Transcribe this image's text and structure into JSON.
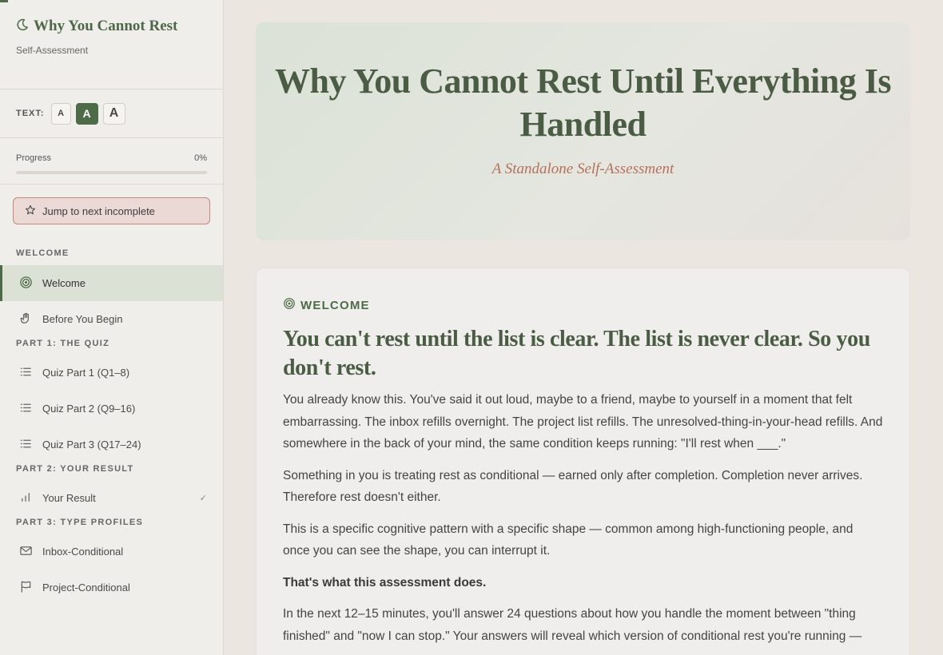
{
  "sidebar": {
    "brand_title": "Why You Cannot Rest",
    "brand_subtitle": "Self-Assessment",
    "text_size_label": "TEXT:",
    "text_size_options": [
      "A",
      "A",
      "A"
    ],
    "progress_label": "Progress",
    "progress_value": "0%",
    "progress_fraction": 0,
    "jump_label": "Jump to next incomplete",
    "sections": [
      {
        "title": "WELCOME",
        "items": [
          {
            "label": "Welcome",
            "icon": "target-icon",
            "active": true
          },
          {
            "label": "Before You Begin",
            "icon": "hand-icon"
          }
        ]
      },
      {
        "title": "PART 1: THE QUIZ",
        "items": [
          {
            "label": "Quiz Part 1 (Q1–8)",
            "icon": "list-icon"
          },
          {
            "label": "Quiz Part 2 (Q9–16)",
            "icon": "list-icon"
          },
          {
            "label": "Quiz Part 3 (Q17–24)",
            "icon": "list-icon"
          }
        ]
      },
      {
        "title": "PART 2: YOUR RESULT",
        "items": [
          {
            "label": "Your Result",
            "icon": "bar-chart-icon",
            "check": "✓"
          }
        ]
      },
      {
        "title": "PART 3: TYPE PROFILES",
        "items": [
          {
            "label": "Inbox-Conditional",
            "icon": "mail-icon"
          },
          {
            "label": "Project-Conditional",
            "icon": "flag-icon"
          }
        ]
      }
    ]
  },
  "hero": {
    "title": "Why You Cannot Rest Until Everything Is Handled",
    "subtitle": "A Standalone Self-Assessment"
  },
  "card": {
    "label": "WELCOME",
    "heading": "You can't rest until the list is clear. The list is never clear. So you don't rest.",
    "paragraphs": [
      "You already know this. You've said it out loud, maybe to a friend, maybe to yourself in a moment that felt embarrassing. The inbox refills overnight. The project list refills. The unresolved-thing-in-your-head refills. And somewhere in the back of your mind, the same condition keeps running: \"I'll rest when ___.\"",
      "Something in you is treating rest as conditional — earned only after completion. Completion never arrives. Therefore rest doesn't either.",
      "This is a specific cognitive pattern with a specific shape — common among high-functioning people, and once you can see the shape, you can interrupt it.",
      "That's what this assessment does.",
      "In the next 12–15 minutes, you'll answer 24 questions about how you handle the moment between \"thing finished\" and \"now I can stop.\" Your answers will reveal which version of conditional rest you're running —"
    ]
  },
  "colors": {
    "accent": "#4e6b47",
    "subtitle": "#b5705a",
    "jump_border": "#c9877a"
  }
}
